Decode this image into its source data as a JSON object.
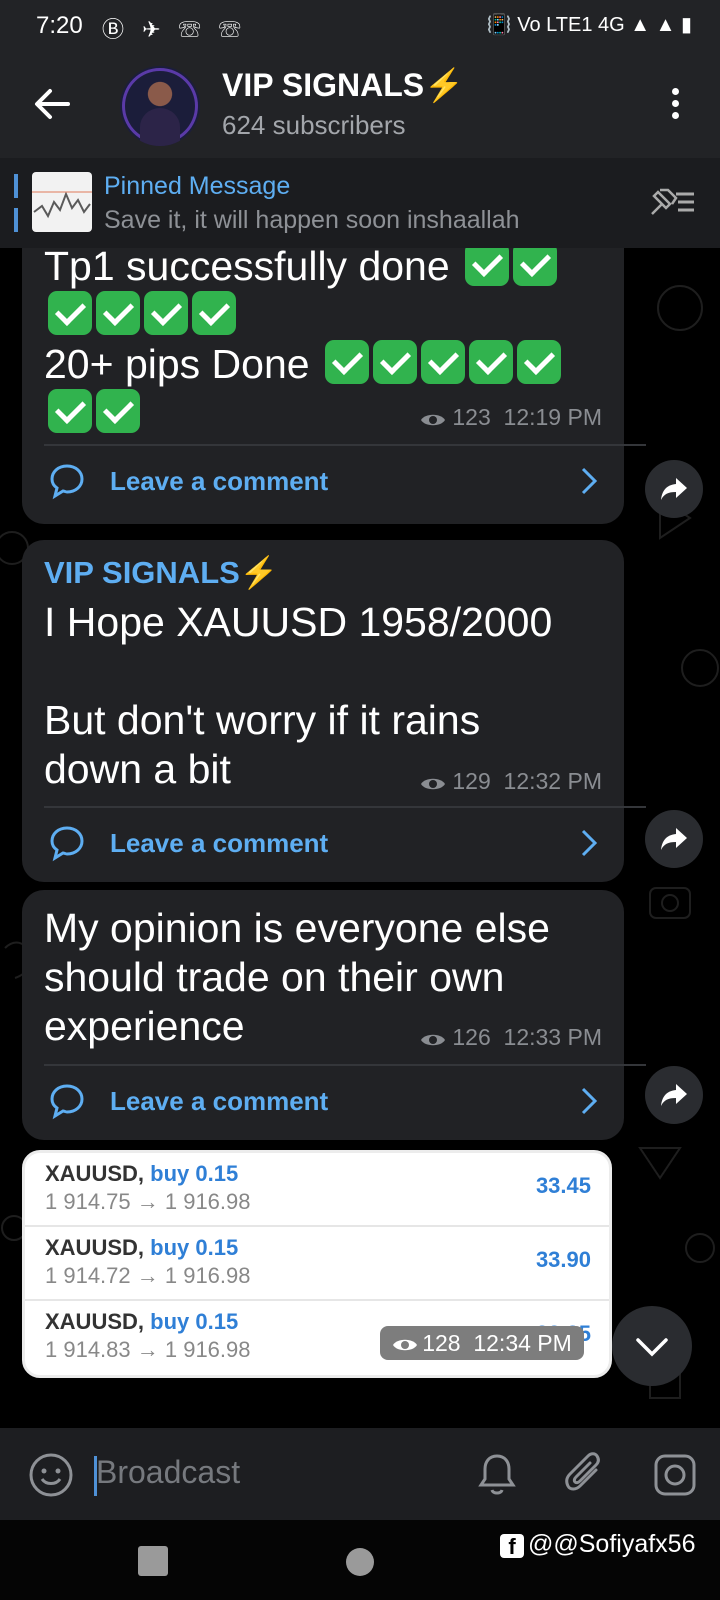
{
  "status_bar": {
    "time": "7:20",
    "left_icons": "Ⓑ ✈ ☏ ☏",
    "right_icons": "📳 Vo LTE1 4G ▲ ▲ ▮"
  },
  "channel": {
    "title": "VIP SIGNALS⚡",
    "subscribers": "624 subscribers"
  },
  "pinned": {
    "title": "Pinned Message",
    "text": "Save it, it will happen soon  inshaallah"
  },
  "messages": [
    {
      "line1": "Tp1 successfully done",
      "line3": "20+ pips Done",
      "views": "123",
      "time": "12:19 PM",
      "comment_label": "Leave a comment"
    },
    {
      "sender": "VIP SIGNALS⚡",
      "line1": "I Hope XAUUSD  1958/2000",
      "line2": "But don't worry if it rains",
      "line3": "down a bit",
      "views": "129",
      "time": "12:32 PM",
      "comment_label": "Leave a comment"
    },
    {
      "line1": "My opinion is everyone else",
      "line2": "should trade on their own",
      "line3": "experience",
      "views": "126",
      "time": "12:33 PM",
      "comment_label": "Leave a comment"
    }
  ],
  "trades": [
    {
      "symbol": "XAUUSD,",
      "action": "buy 0.15",
      "prices": "1 914.75 → 1 916.98",
      "profit": "33.45"
    },
    {
      "symbol": "XAUUSD,",
      "action": "buy 0.15",
      "prices": "1 914.72 → 1 916.98",
      "profit": "33.90"
    },
    {
      "symbol": "XAUUSD,",
      "action": "buy 0.15",
      "prices": "1 914.83 → 1 916.98",
      "profit": "32.25"
    }
  ],
  "image_meta": {
    "views": "128",
    "time": "12:34 PM"
  },
  "input": {
    "placeholder": "Broadcast"
  },
  "watermark": {
    "text": "@@Sofiyafx56",
    "icon_letter": "f"
  },
  "colors": {
    "accent": "#5eaef2",
    "bubble": "#212225",
    "bg": "#000000",
    "check": "#31b34e"
  }
}
